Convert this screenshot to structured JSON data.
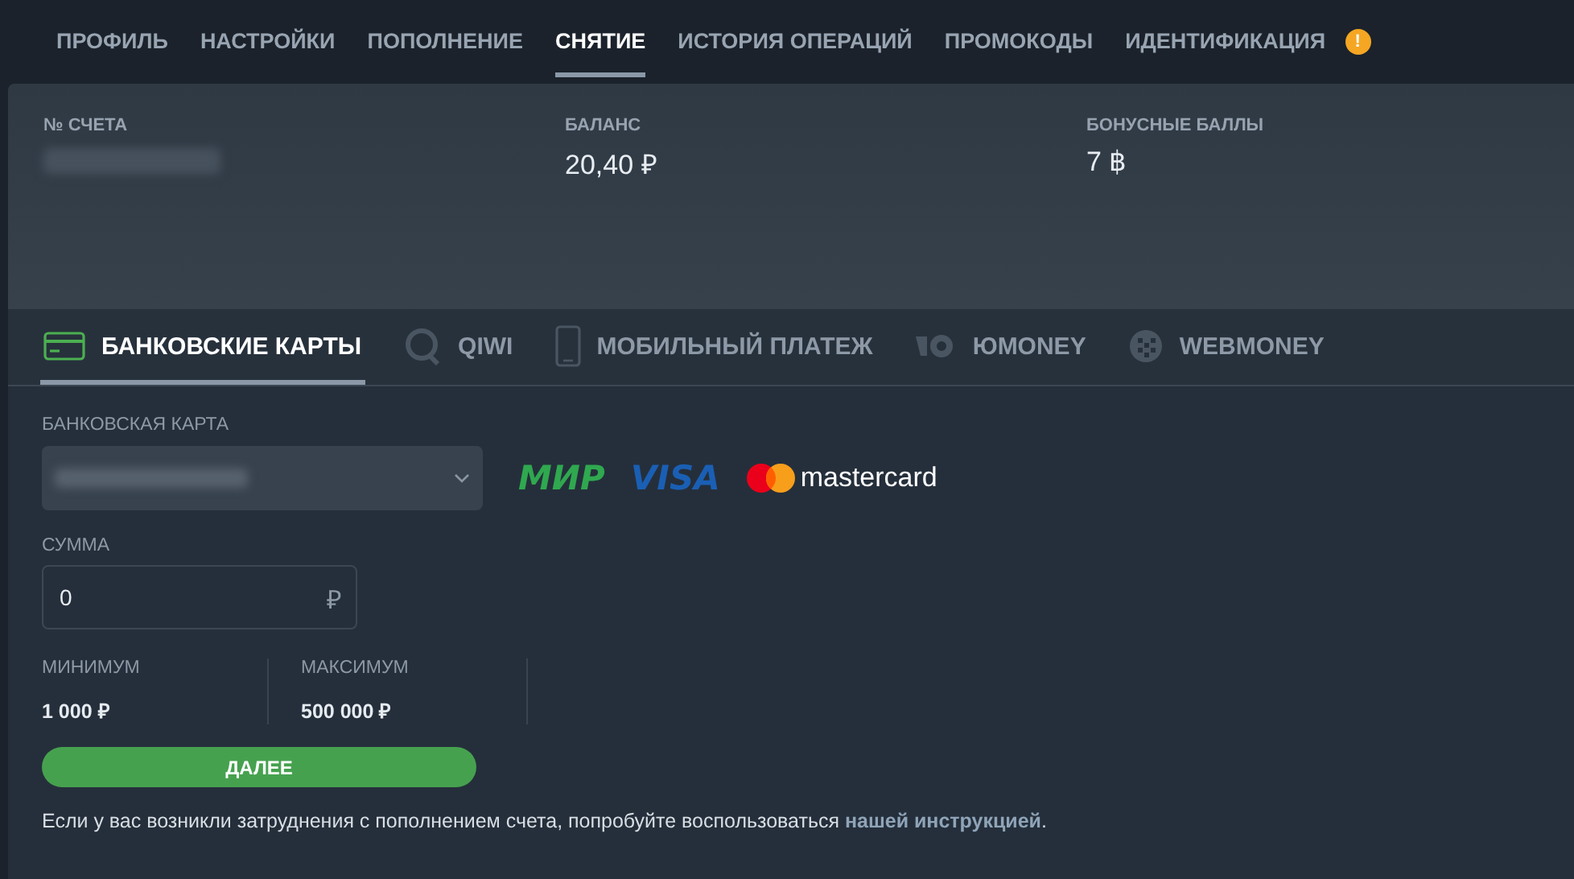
{
  "tabs": [
    {
      "label": "ПРОФИЛЬ",
      "selected": false,
      "alert": false
    },
    {
      "label": "НАСТРОЙКИ",
      "selected": false,
      "alert": false
    },
    {
      "label": "ПОПОЛНЕНИЕ",
      "selected": false,
      "alert": false
    },
    {
      "label": "СНЯТИЕ",
      "selected": true,
      "alert": false
    },
    {
      "label": "ИСТОРИЯ ОПЕРАЦИЙ",
      "selected": false,
      "alert": false
    },
    {
      "label": "ПРОМОКОДЫ",
      "selected": false,
      "alert": false
    },
    {
      "label": "ИДЕНТИФИКАЦИЯ",
      "selected": false,
      "alert": true,
      "alert_mark": "!"
    }
  ],
  "account": [
    {
      "label": "№ СЧЕТА",
      "kind": "hidden"
    },
    {
      "label": "БАЛАНС",
      "kind": "value",
      "value": "20,40 ₽"
    },
    {
      "label": "БОНУСНЫЕ БАЛЛЫ",
      "kind": "value",
      "value": "7 ฿"
    }
  ],
  "methods": [
    {
      "label": "БАНКОВСКИЕ КАРТЫ",
      "kind": "card",
      "selected": true
    },
    {
      "label": "QIWI",
      "kind": "qiwi",
      "selected": false
    },
    {
      "label": "МОБИЛЬНЫЙ ПЛАТЕЖ",
      "kind": "phone",
      "selected": false
    },
    {
      "label": "ЮMONEY",
      "kind": "yumoney",
      "selected": false
    },
    {
      "label": "WEBMONEY",
      "kind": "webmoney",
      "selected": false
    }
  ],
  "card_field": {
    "label": "БАНКОВСКАЯ КАРТА"
  },
  "brands": [
    {
      "kind": "mir",
      "text": "МИР"
    },
    {
      "kind": "visa",
      "text": "VISA"
    },
    {
      "kind": "mastercard",
      "text": "mastercard"
    }
  ],
  "amount": {
    "label": "СУММА",
    "value": "0",
    "currency": "₽"
  },
  "limits": [
    {
      "label": "МИНИМУМ",
      "value": "1 000 ₽"
    },
    {
      "label": "МАКСИМУМ",
      "value": "500 000 ₽"
    }
  ],
  "submit": "ДАЛЕЕ",
  "hint": {
    "before": "Если у вас возникли затруднения с пополнением счета, попробуйте воспользоваться ",
    "link": "нашей инструкцией",
    "after": "."
  }
}
